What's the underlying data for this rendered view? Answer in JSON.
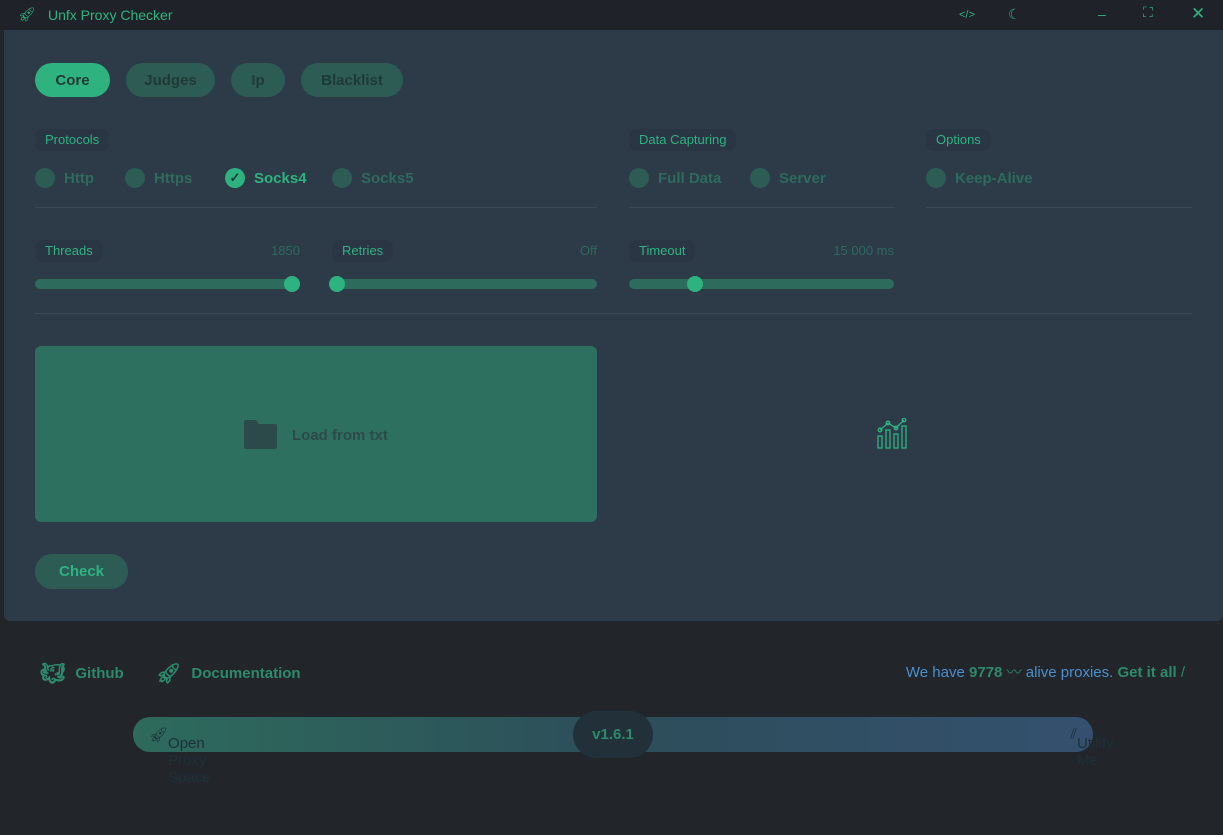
{
  "app": {
    "title": "Unfx Proxy Checker"
  },
  "titlebar": {
    "icons": [
      "rocket-icon",
      "code-icon",
      "moon-icon",
      "minimize-icon",
      "maximize-icon",
      "close-icon"
    ]
  },
  "tabs": [
    {
      "label": "Core",
      "active": true
    },
    {
      "label": "Judges"
    },
    {
      "label": "Ip"
    },
    {
      "label": "Blacklist"
    }
  ],
  "protocols": {
    "label": "Protocols",
    "items": [
      {
        "label": "Http",
        "checked": false
      },
      {
        "label": "Https",
        "checked": false
      },
      {
        "label": "Socks4",
        "checked": true
      },
      {
        "label": "Socks5",
        "checked": false
      }
    ]
  },
  "capturing": {
    "label": "Data Capturing",
    "items": [
      {
        "label": "Full Data",
        "checked": false
      },
      {
        "label": "Server",
        "checked": false
      }
    ]
  },
  "options": {
    "label": "Options",
    "items": [
      {
        "label": "Keep-Alive",
        "checked": false
      }
    ]
  },
  "sliders": {
    "threads": {
      "label": "Threads",
      "value": "1850",
      "fill_percent": 97
    },
    "retries": {
      "label": "Retries",
      "value": "Off",
      "fill_percent": 2
    },
    "timeout": {
      "label": "Timeout",
      "value": "15 000 ms",
      "fill_percent": 25
    }
  },
  "load": {
    "label": "Load from txt"
  },
  "check": {
    "label": "Check"
  },
  "footer": {
    "github": "Github",
    "docs": "Documentation",
    "stats_prefix": "We have",
    "stats_count": "9778",
    "stats_suffix": "alive proxies.",
    "get_all": "Get it all"
  },
  "bar": {
    "left": "Open Proxy Space",
    "version": "v1.6.1",
    "right": "Utilify Me"
  },
  "colors": {
    "accent": "#2eb380",
    "panel": "#2d3a48",
    "titlebar": "#1f2329",
    "link_blue": "#4a90d0"
  }
}
